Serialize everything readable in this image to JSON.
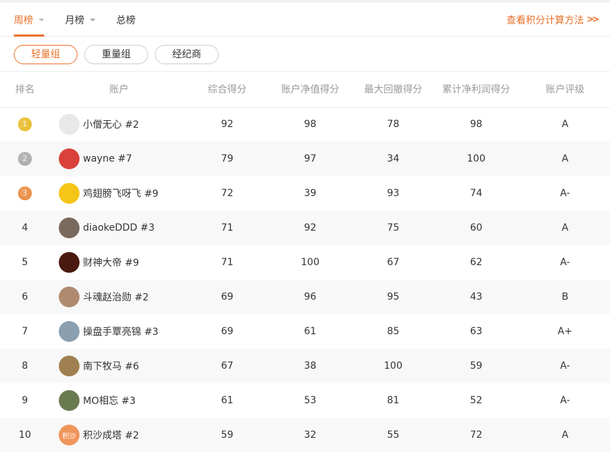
{
  "tabs": [
    {
      "label": "周榜",
      "active": true,
      "dropdown": true
    },
    {
      "label": "月榜",
      "active": false,
      "dropdown": true
    },
    {
      "label": "总榜",
      "active": false,
      "dropdown": false
    }
  ],
  "calc_link": {
    "label": "查看积分计算方法",
    "icon": "double-chevron-right-icon"
  },
  "groups": [
    {
      "label": "轻量组",
      "active": true
    },
    {
      "label": "重量组",
      "active": false
    },
    {
      "label": "经纪商",
      "active": false
    }
  ],
  "colors": {
    "accent": "#e8702a",
    "gold": "#e8b923",
    "silver": "#a8a8a8",
    "bronze": "#e8873a"
  },
  "table": {
    "headers": [
      "排名",
      "账户",
      "综合得分",
      "账户净值得分",
      "最大回撤得分",
      "累计净利润得分",
      "账户评级"
    ],
    "rows": [
      {
        "rank": "1",
        "medal": "gold",
        "name": "小僧无心 #2",
        "avatar_bg": "#e8e8e8",
        "avatar_text": "",
        "total": "92",
        "nav": "98",
        "drawdown": "78",
        "profit": "98",
        "grade": "A"
      },
      {
        "rank": "2",
        "medal": "silver",
        "name": "wayne #7",
        "avatar_bg": "#d9423a",
        "avatar_text": "",
        "total": "79",
        "nav": "97",
        "drawdown": "34",
        "profit": "100",
        "grade": "A"
      },
      {
        "rank": "3",
        "medal": "bronze",
        "name": "鸡翅膀飞呀飞 #9",
        "avatar_bg": "#f5c518",
        "avatar_text": "",
        "total": "72",
        "nav": "39",
        "drawdown": "93",
        "profit": "74",
        "grade": "A-"
      },
      {
        "rank": "4",
        "medal": "",
        "name": "diaokeDDD #3",
        "avatar_bg": "#7a6a5e",
        "avatar_text": "",
        "total": "71",
        "nav": "92",
        "drawdown": "75",
        "profit": "60",
        "grade": "A"
      },
      {
        "rank": "5",
        "medal": "",
        "name": "财神大帝 #9",
        "avatar_bg": "#4a1a10",
        "avatar_text": "",
        "total": "71",
        "nav": "100",
        "drawdown": "67",
        "profit": "62",
        "grade": "A-"
      },
      {
        "rank": "6",
        "medal": "",
        "name": "斗魂赵治勋 #2",
        "avatar_bg": "#b08a70",
        "avatar_text": "",
        "total": "69",
        "nav": "96",
        "drawdown": "95",
        "profit": "43",
        "grade": "B"
      },
      {
        "rank": "7",
        "medal": "",
        "name": "操盘手覃亮锦 #3",
        "avatar_bg": "#8aa0b0",
        "avatar_text": "",
        "total": "69",
        "nav": "61",
        "drawdown": "85",
        "profit": "63",
        "grade": "A+"
      },
      {
        "rank": "8",
        "medal": "",
        "name": "南下牧马 #6",
        "avatar_bg": "#a08050",
        "avatar_text": "",
        "total": "67",
        "nav": "38",
        "drawdown": "100",
        "profit": "59",
        "grade": "A-"
      },
      {
        "rank": "9",
        "medal": "",
        "name": "MO相忘 #3",
        "avatar_bg": "#6a7a50",
        "avatar_text": "",
        "total": "61",
        "nav": "53",
        "drawdown": "81",
        "profit": "52",
        "grade": "A-"
      },
      {
        "rank": "10",
        "medal": "",
        "name": "积沙成塔 #2",
        "avatar_bg": "#f0955a",
        "avatar_text": "积沙",
        "total": "59",
        "nav": "32",
        "drawdown": "55",
        "profit": "72",
        "grade": "A"
      }
    ]
  }
}
